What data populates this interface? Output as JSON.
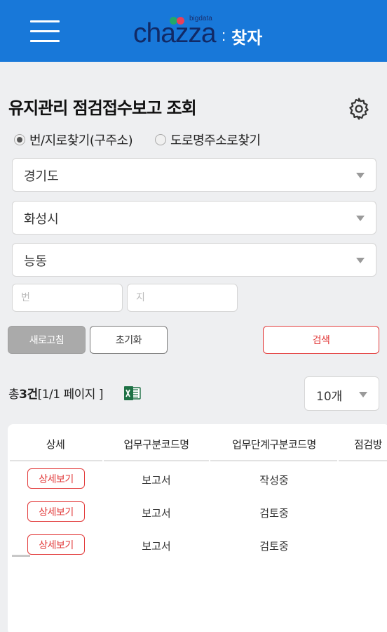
{
  "header": {
    "logo_text": "chazza",
    "logo_colon": ":",
    "logo_korean": "찾자",
    "logo_tag": "bigdata",
    "brand_color": "#1878d9"
  },
  "page": {
    "title": "유지관리 점검접수보고 조회"
  },
  "search_mode": {
    "options": [
      {
        "label": "번/지로찾기(구주소)",
        "selected": true
      },
      {
        "label": "도로명주소로찾기",
        "selected": false
      }
    ]
  },
  "filters": {
    "province": "경기도",
    "city": "화성시",
    "district": "능동",
    "bun_placeholder": "번",
    "ji_placeholder": "지"
  },
  "buttons": {
    "refresh": "새로고침",
    "reset": "초기화",
    "search": "검색"
  },
  "results": {
    "count_prefix": "총 ",
    "count_value": "3건",
    "page_info": "[1/1 페이지 ]",
    "page_size": "10개"
  },
  "table": {
    "headers": [
      "상세",
      "업무구분코드명",
      "업무단계구분코드명",
      "점검방"
    ],
    "detail_label": "상세보기",
    "rows": [
      {
        "type": "보고서",
        "stage": "작성중"
      },
      {
        "type": "보고서",
        "stage": "검토중"
      },
      {
        "type": "보고서",
        "stage": "검토중"
      }
    ]
  }
}
